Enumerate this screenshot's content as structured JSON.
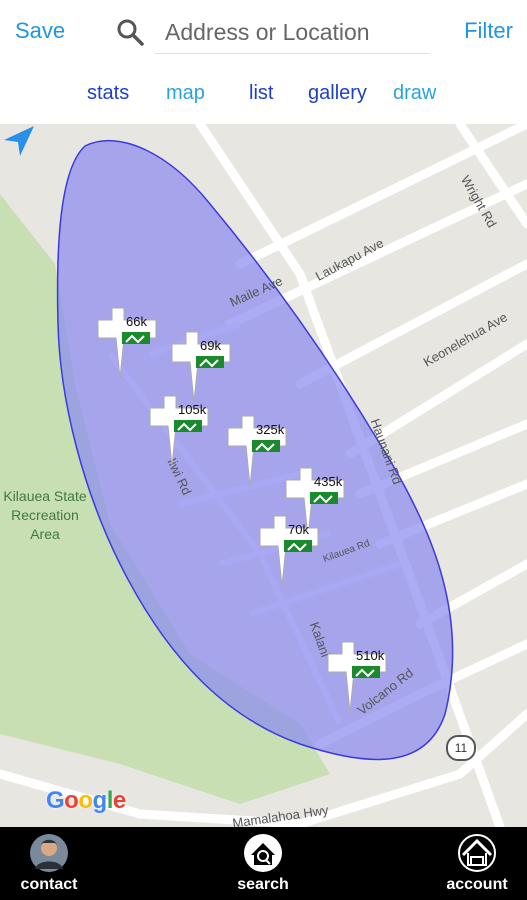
{
  "header": {
    "save_label": "Save",
    "filter_label": "Filter",
    "search_placeholder": "Address or Location"
  },
  "tabs": [
    {
      "label": "stats"
    },
    {
      "label": "map"
    },
    {
      "label": "list"
    },
    {
      "label": "gallery"
    },
    {
      "label": "draw"
    }
  ],
  "map": {
    "listings": [
      {
        "price": "66k"
      },
      {
        "price": "69k"
      },
      {
        "price": "105k"
      },
      {
        "price": "325k"
      },
      {
        "price": "435k"
      },
      {
        "price": "70k"
      },
      {
        "price": "510k"
      }
    ],
    "roads": {
      "maile": "Maile Ave",
      "laukapu": "Laukapu Ave",
      "keonelehua": "Keonelehua Ave",
      "wright": "Wright Rd",
      "haunani": "Haunani Rd",
      "iiwi": "Iiwi Rd",
      "kilauea": "Kilauea Rd",
      "kalani": "Kalani",
      "volcano": "Volcano Rd",
      "mamalahoa": "Mamalahoa Hwy"
    },
    "park_label": "Kilauea State Recreation Area",
    "highway_shield": "11",
    "attribution": "Google",
    "colors": {
      "polygon_fill": "#8c8cf0",
      "polygon_stroke": "#3a3ae0",
      "park": "#c8dfb4",
      "marker_green": "#1a8a2c"
    }
  },
  "bottom_nav": [
    {
      "label": "contact",
      "icon": "agent-avatar-icon"
    },
    {
      "label": "search",
      "icon": "house-search-icon"
    },
    {
      "label": "account",
      "icon": "house-account-icon"
    }
  ]
}
